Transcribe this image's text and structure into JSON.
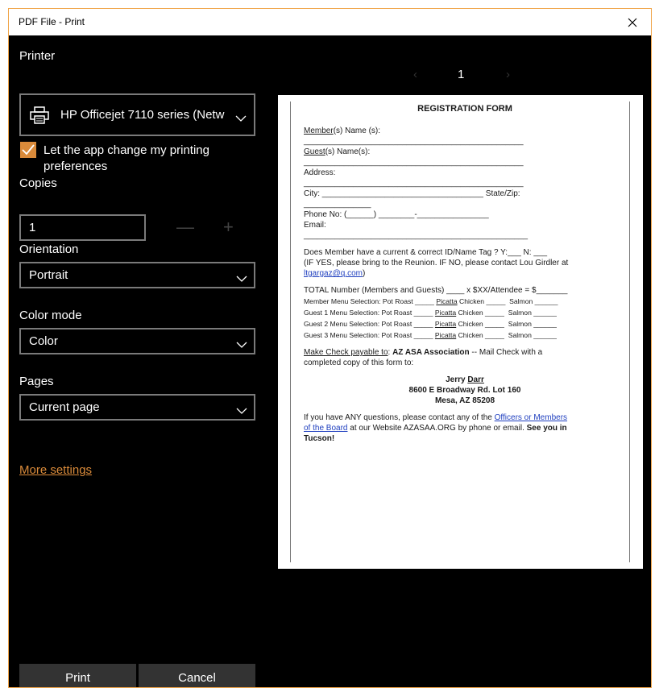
{
  "window": {
    "title": "PDF File - Print"
  },
  "printer": {
    "label": "Printer",
    "selected": "HP Officejet 7110 series (Netw",
    "allow_app_prefs_label": "Let the app change my printing preferences",
    "allow_app_prefs_checked": true
  },
  "copies": {
    "label": "Copies",
    "value": "1",
    "decrement": "—",
    "increment": "+"
  },
  "orientation": {
    "label": "Orientation",
    "value": "Portrait"
  },
  "color_mode": {
    "label": "Color mode",
    "value": "Color"
  },
  "pages": {
    "label": "Pages",
    "value": "Current page"
  },
  "more_settings": "More settings",
  "buttons": {
    "print": "Print",
    "cancel": "Cancel"
  },
  "preview": {
    "page_number": "1",
    "prev": "‹",
    "next": "›",
    "document": {
      "title": "REGISTRATION FORM",
      "member_name_u": "Member",
      "member_name_rest": "(s) Name (s):",
      "member_line": "_________________________________________________",
      "guest_name_u": "Guest",
      "guest_name_rest": "(s) Name(s):",
      "guest_line": "_________________________________________________",
      "address": "Address:",
      "address_line": "_________________________________________________",
      "city_line": "City: ____________________________________ State/Zip:",
      "statezip_line": "_______________",
      "phone": "Phone No: (______) ________-________________",
      "email": "Email:",
      "email_line": "__________________________________________________",
      "id_question": "Does Member have a current & correct ID/Name Tag ? Y:___ N: ___",
      "id_if_yes": "(IF YES, please bring to the Reunion.  IF NO, please contact Lou Girdler at",
      "id_email": "ltgargaz@q.com",
      "id_email_close": ")",
      "total": "TOTAL Number (Members and Guests) ____ x $XX/Attendee = $_______",
      "menu": [
        {
          "who": "Member Menu Selection:",
          "roast": "Pot Roast _____",
          "picatta": "Picatta",
          "chicken": "Chicken _____",
          "salmon": "Salmon ______"
        },
        {
          "who": "Guest 1 Menu Selection:",
          "roast": "Pot Roast _____",
          "picatta": "Picatta",
          "chicken": "Chicken _____",
          "salmon": "Salmon ______"
        },
        {
          "who": "Guest 2 Menu Selection:",
          "roast": "Pot Roast _____",
          "picatta": "Picatta",
          "chicken": "Chicken _____",
          "salmon": "Salmon ______"
        },
        {
          "who": "Guest 3 Menu Selection:",
          "roast": "Pot Roast _____",
          "picatta": "Picatta",
          "chicken": "Chicken _____",
          "salmon": "Salmon ______"
        }
      ],
      "payable_u": "Make Check payable to",
      "payable_colon": ": ",
      "payable_org": "AZ ASA Association",
      "payable_rest": " -- Mail Check with a",
      "payable_line2": "completed copy of this form to:",
      "addr_name_first": "Jerry ",
      "addr_name_last": "Darr",
      "addr_street": "8600 E Broadway Rd. Lot 160",
      "addr_city": "Mesa, AZ 85208",
      "q_line1": "If you have ANY questions, please contact any of the ",
      "q_link1": "Officers or Members",
      "q_link2": "of the Board",
      "q_line2": " at our Website AZASAA.ORG by phone or email. ",
      "q_bold": "See you in",
      "q_bold2": "Tucson!"
    }
  }
}
